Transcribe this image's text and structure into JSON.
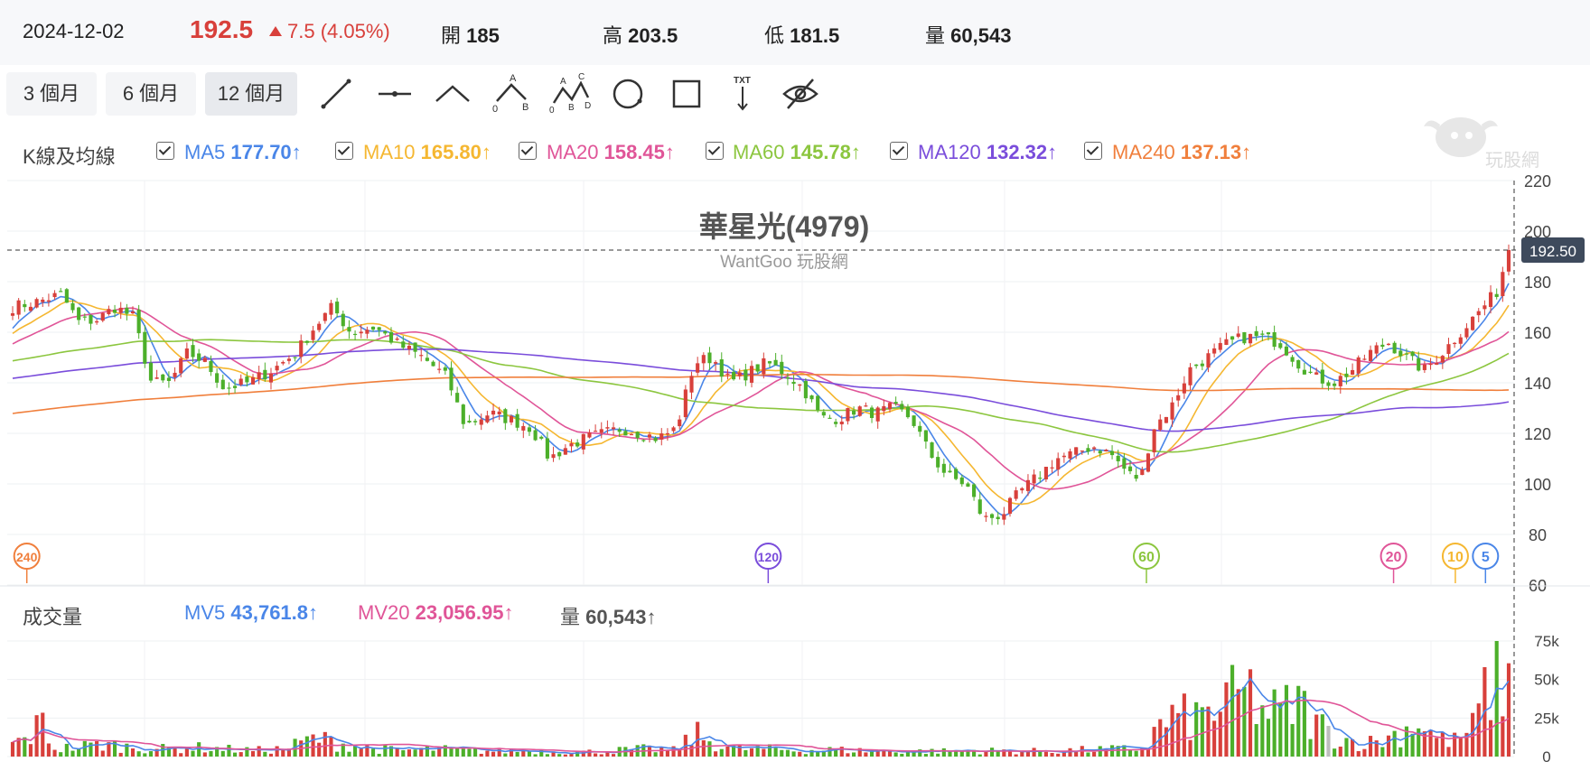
{
  "header": {
    "date": "2024-12-02",
    "price": "192.5",
    "change": "7.5 (4.05%)",
    "open_label": "開",
    "open": "185",
    "high_label": "高",
    "high": "203.5",
    "low_label": "低",
    "low": "181.5",
    "volume_label": "量",
    "volume": "60,543"
  },
  "colors": {
    "up": "#d8403b",
    "down": "#4caf2a",
    "neutral": "#bdbdbd",
    "ma5": "#4a86e8",
    "ma10": "#f5b731",
    "ma20": "#e05598",
    "ma60": "#8cc63f",
    "ma120": "#7a4ddb",
    "ma240": "#f07f3c"
  },
  "toolbar": {
    "ranges": [
      {
        "label": "3 個月",
        "active": false
      },
      {
        "label": "6 個月",
        "active": false
      },
      {
        "label": "12 個月",
        "active": true
      }
    ],
    "tools": [
      "line-tool-icon",
      "horizontal-line-tool-icon",
      "polyline-tool-icon",
      "abc-pattern-tool-icon",
      "abcd-pattern-tool-icon",
      "circle-tool-icon",
      "rectangle-tool-icon",
      "text-tool-icon",
      "hide-drawings-icon"
    ],
    "tool_text": {
      "abc": [
        "A",
        "0",
        "B"
      ],
      "abcd": [
        "A",
        "C",
        "0",
        "B",
        "D"
      ],
      "txt": "TXT"
    }
  },
  "legend": {
    "title": "K線及均線",
    "items": [
      {
        "name": "MA5",
        "value": "177.70",
        "arrow": "↑",
        "color": "#4a86e8"
      },
      {
        "name": "MA10",
        "value": "165.80",
        "arrow": "↑",
        "color": "#f5b731"
      },
      {
        "name": "MA20",
        "value": "158.45",
        "arrow": "↑",
        "color": "#e05598"
      },
      {
        "name": "MA60",
        "value": "145.78",
        "arrow": "↑",
        "color": "#8cc63f"
      },
      {
        "name": "MA120",
        "value": "132.32",
        "arrow": "↑",
        "color": "#7a4ddb"
      },
      {
        "name": "MA240",
        "value": "137.13",
        "arrow": "↑",
        "color": "#f07f3c"
      }
    ]
  },
  "volume_legend": {
    "title": "成交量",
    "items": [
      {
        "name": "MV5",
        "value": "43,761.8",
        "arrow": "↑",
        "color": "#4a86e8"
      },
      {
        "name": "MV20",
        "value": "23,056.95",
        "arrow": "↑",
        "color": "#e05598"
      },
      {
        "name": "量",
        "value": "60,543",
        "arrow": "↑",
        "color": "#555"
      }
    ]
  },
  "watermark_text": "玩股網",
  "chart_data": {
    "type": "candlestick",
    "title": "華星光(4979)",
    "subtitle": "WantGoo 玩股網",
    "price_axis": {
      "ticks": [
        220,
        200,
        180,
        160,
        140,
        120,
        100,
        80,
        60
      ],
      "ylim": [
        60,
        220
      ]
    },
    "volume_axis": {
      "ticks": [
        "75k",
        "50k",
        "25k",
        "0"
      ],
      "ylim": [
        0,
        75000
      ]
    },
    "last_price_tag": "192.50",
    "last_price": 192.5,
    "ma_markers": [
      {
        "label": "240",
        "color": "#f07f3c",
        "x_frac": 0.013
      },
      {
        "label": "120",
        "color": "#7a4ddb",
        "x_frac": 0.505
      },
      {
        "label": "60",
        "color": "#8cc63f",
        "x_frac": 0.756
      },
      {
        "label": "20",
        "color": "#e05598",
        "x_frac": 0.92
      },
      {
        "label": "10",
        "color": "#f5b731",
        "x_frac": 0.961
      },
      {
        "label": "5",
        "color": "#4a86e8",
        "x_frac": 0.981
      }
    ],
    "close_keypoints": [
      [
        0,
        170
      ],
      [
        8,
        172
      ],
      [
        16,
        175
      ],
      [
        22,
        164
      ],
      [
        28,
        165
      ],
      [
        34,
        170
      ],
      [
        40,
        166
      ],
      [
        46,
        140
      ],
      [
        52,
        140
      ],
      [
        58,
        152
      ],
      [
        64,
        148
      ],
      [
        70,
        138
      ],
      [
        78,
        140
      ],
      [
        86,
        145
      ],
      [
        94,
        152
      ],
      [
        100,
        162
      ],
      [
        106,
        170
      ],
      [
        112,
        160
      ],
      [
        120,
        162
      ],
      [
        128,
        155
      ],
      [
        136,
        150
      ],
      [
        144,
        142
      ],
      [
        150,
        123
      ],
      [
        158,
        128
      ],
      [
        166,
        125
      ],
      [
        172,
        122
      ],
      [
        178,
        110
      ],
      [
        184,
        115
      ],
      [
        190,
        118
      ],
      [
        196,
        120
      ],
      [
        202,
        122
      ],
      [
        208,
        120
      ],
      [
        214,
        118
      ],
      [
        220,
        122
      ],
      [
        226,
        148
      ],
      [
        232,
        150
      ],
      [
        238,
        140
      ],
      [
        244,
        144
      ],
      [
        250,
        148
      ],
      [
        256,
        144
      ],
      [
        262,
        138
      ],
      [
        268,
        126
      ],
      [
        274,
        126
      ],
      [
        280,
        130
      ],
      [
        286,
        128
      ],
      [
        292,
        130
      ],
      [
        298,
        126
      ],
      [
        304,
        112
      ],
      [
        310,
        103
      ],
      [
        316,
        100
      ],
      [
        322,
        86
      ],
      [
        328,
        88
      ],
      [
        334,
        97
      ],
      [
        340,
        103
      ],
      [
        346,
        110
      ],
      [
        352,
        112
      ],
      [
        358,
        115
      ],
      [
        364,
        112
      ],
      [
        370,
        104
      ],
      [
        374,
        102
      ],
      [
        378,
        122
      ],
      [
        384,
        130
      ],
      [
        390,
        145
      ],
      [
        396,
        150
      ],
      [
        402,
        155
      ],
      [
        408,
        158
      ],
      [
        414,
        158
      ],
      [
        420,
        156
      ],
      [
        426,
        148
      ],
      [
        432,
        142
      ],
      [
        438,
        140
      ],
      [
        444,
        145
      ],
      [
        450,
        152
      ],
      [
        456,
        156
      ],
      [
        462,
        150
      ],
      [
        468,
        145
      ],
      [
        474,
        152
      ],
      [
        480,
        160
      ],
      [
        486,
        168
      ],
      [
        492,
        176
      ],
      [
        496,
        192.5
      ]
    ],
    "candle_count": 250,
    "ma_periods": [
      5,
      10,
      20,
      60,
      120,
      240
    ],
    "ma_prior_start": 100,
    "volume_keypoints": [
      [
        0,
        8000
      ],
      [
        5,
        12000
      ],
      [
        10,
        22000
      ],
      [
        14,
        5000
      ],
      [
        20,
        6000
      ],
      [
        30,
        8000
      ],
      [
        40,
        6000
      ],
      [
        50,
        5000
      ],
      [
        60,
        6000
      ],
      [
        70,
        5000
      ],
      [
        80,
        4000
      ],
      [
        90,
        5000
      ],
      [
        100,
        12000
      ],
      [
        110,
        8000
      ],
      [
        120,
        5000
      ],
      [
        130,
        4000
      ],
      [
        140,
        5000
      ],
      [
        150,
        4000
      ],
      [
        160,
        3500
      ],
      [
        170,
        4000
      ],
      [
        180,
        3500
      ],
      [
        190,
        3000
      ],
      [
        200,
        4000
      ],
      [
        210,
        5000
      ],
      [
        220,
        4000
      ],
      [
        226,
        15000
      ],
      [
        232,
        9000
      ],
      [
        240,
        5000
      ],
      [
        250,
        5000
      ],
      [
        260,
        4000
      ],
      [
        270,
        4500
      ],
      [
        280,
        4000
      ],
      [
        290,
        3500
      ],
      [
        300,
        3500
      ],
      [
        310,
        3500
      ],
      [
        320,
        4000
      ],
      [
        330,
        3500
      ],
      [
        340,
        3500
      ],
      [
        350,
        4000
      ],
      [
        360,
        4500
      ],
      [
        370,
        5000
      ],
      [
        376,
        6000
      ],
      [
        380,
        20000
      ],
      [
        386,
        26000
      ],
      [
        392,
        24000
      ],
      [
        398,
        30000
      ],
      [
        404,
        36000
      ],
      [
        410,
        42000
      ],
      [
        414,
        30000
      ],
      [
        420,
        28000
      ],
      [
        426,
        35000
      ],
      [
        432,
        22000
      ],
      [
        438,
        14000
      ],
      [
        444,
        10000
      ],
      [
        450,
        9000
      ],
      [
        456,
        12000
      ],
      [
        462,
        18000
      ],
      [
        466,
        24000
      ],
      [
        472,
        12000
      ],
      [
        478,
        10000
      ],
      [
        484,
        18000
      ],
      [
        488,
        40000
      ],
      [
        492,
        48000
      ],
      [
        496,
        60543
      ]
    ]
  }
}
